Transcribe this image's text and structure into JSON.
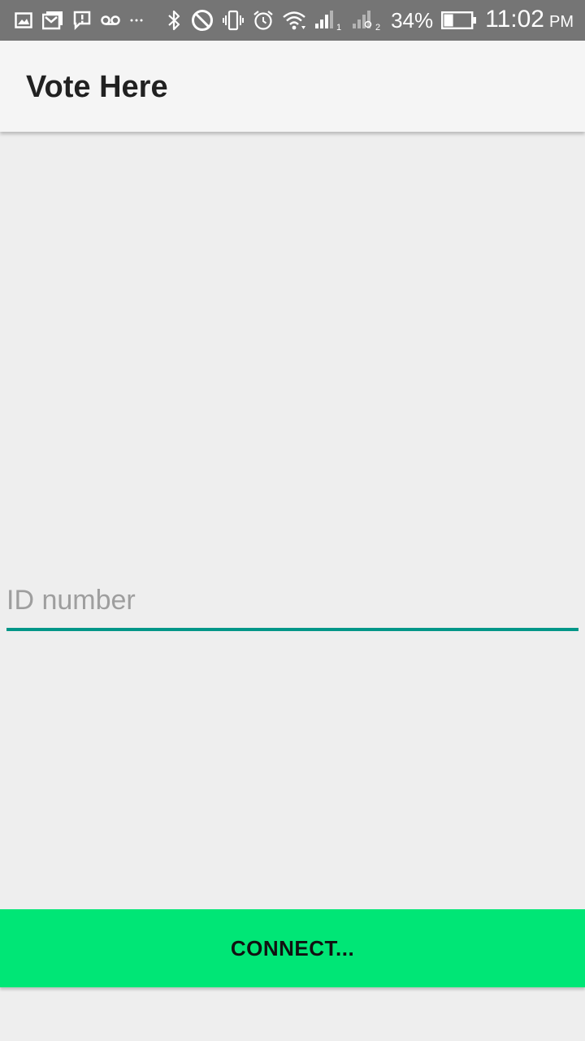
{
  "status_bar": {
    "left_icons": [
      "gallery-icon",
      "gmail-icon",
      "message-alert-icon",
      "voicemail-icon",
      "more-dots-icon"
    ],
    "right_icons": [
      "bluetooth-icon",
      "do-not-disturb-icon",
      "vibrate-icon",
      "alarm-icon",
      "wifi-icon",
      "signal-sim1-icon",
      "signal-sim2-icon",
      "battery-icon"
    ],
    "sim1_label": "1",
    "sim2_label": "2",
    "battery_percent": "34%",
    "battery_level": 0.34,
    "time": "11:02",
    "ampm": "PM"
  },
  "app_bar": {
    "title": "Vote Here",
    "background": "#f5f5f5"
  },
  "form": {
    "id_placeholder": "ID number",
    "id_value": "",
    "accent_color": "#009688"
  },
  "connect_button": {
    "label": "CONNECT...",
    "color": "#00e676"
  }
}
